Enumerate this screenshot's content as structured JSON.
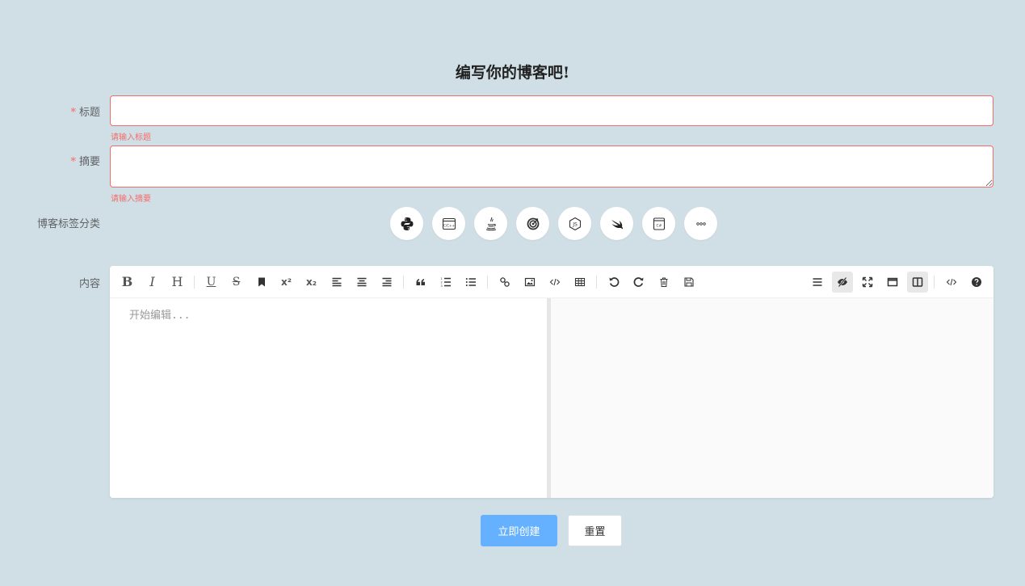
{
  "page": {
    "title": "编写你的博客吧!"
  },
  "form": {
    "title_label": "标题",
    "title_required": "*",
    "title_error": "请输入标题",
    "summary_label": "摘要",
    "summary_required": "*",
    "summary_error": "请输入摘要",
    "tags_label": "博客标签分类",
    "content_label": "内容",
    "tags": [
      {
        "icon": "python-icon"
      },
      {
        "icon": "cpp-icon"
      },
      {
        "icon": "java-icon"
      },
      {
        "icon": "target-icon"
      },
      {
        "icon": "nodejs-icon"
      },
      {
        "icon": "swift-icon"
      },
      {
        "icon": "csharp-icon"
      },
      {
        "icon": "more-icon"
      }
    ]
  },
  "editor": {
    "placeholder": "开始编辑...",
    "toolbar_left": {
      "bold": "B",
      "italic": "I",
      "header": "H",
      "underline": "U",
      "strikethrough": "S",
      "superscript": "x²",
      "subscript": "x₂"
    }
  },
  "actions": {
    "create_label": "立即创建",
    "reset_label": "重置"
  },
  "colors": {
    "background": "#d0dfe6",
    "error": "#f56c6c",
    "primary": "#66b1ff"
  }
}
